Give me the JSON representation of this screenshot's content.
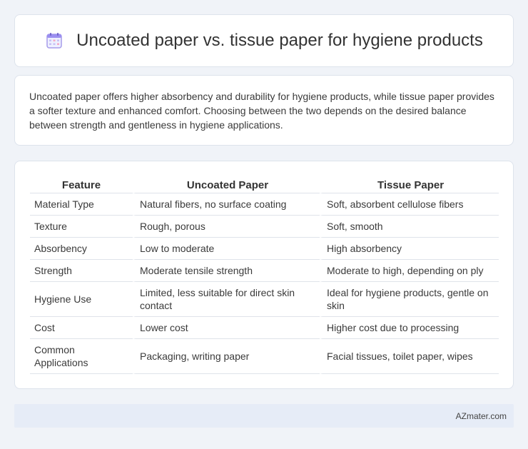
{
  "header": {
    "title": "Uncoated paper vs. tissue paper for hygiene products",
    "icon": "calendar-icon"
  },
  "summary": {
    "text": "Uncoated paper offers higher absorbency and durability for hygiene products, while tissue paper provides a softer texture and enhanced comfort. Choosing between the two depends on the desired balance between strength and gentleness in hygiene applications."
  },
  "table": {
    "headers": [
      "Feature",
      "Uncoated Paper",
      "Tissue Paper"
    ],
    "rows": [
      [
        "Material Type",
        "Natural fibers, no surface coating",
        "Soft, absorbent cellulose fibers"
      ],
      [
        "Texture",
        "Rough, porous",
        "Soft, smooth"
      ],
      [
        "Absorbency",
        "Low to moderate",
        "High absorbency"
      ],
      [
        "Strength",
        "Moderate tensile strength",
        "Moderate to high, depending on ply"
      ],
      [
        "Hygiene Use",
        "Limited, less suitable for direct skin contact",
        "Ideal for hygiene products, gentle on skin"
      ],
      [
        "Cost",
        "Lower cost",
        "Higher cost due to processing"
      ],
      [
        "Common Applications",
        "Packaging, writing paper",
        "Facial tissues, toilet paper, wipes"
      ]
    ]
  },
  "footer": {
    "text": "AZmater.com"
  },
  "colors": {
    "background": "#f0f3f8",
    "card": "#ffffff",
    "footer_bar": "#e6ecf7",
    "icon_accent": "#7c6fd6"
  }
}
